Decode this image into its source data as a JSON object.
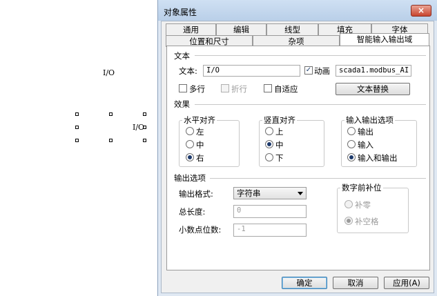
{
  "canvas": {
    "io_label_1": "I/O",
    "io_label_2": "I/O"
  },
  "dialog": {
    "title": "对象属性",
    "close_icon": "×",
    "tabs_row1": [
      "通用",
      "编辑",
      "线型",
      "填充",
      "字体"
    ],
    "tabs_row2": [
      "位置和尺寸",
      "杂项",
      "智能输入输出域"
    ],
    "active_tab": "智能输入输出域",
    "text_section": {
      "title": "文本",
      "text_label": "文本:",
      "text_value": "I/O",
      "animate_label": "动画",
      "animate_checked": true,
      "variable_value": "scada1.modbus_AI",
      "multiline_label": "多行",
      "wrap_label": "折行",
      "autofit_label": "自适应",
      "replace_button": "文本替换"
    },
    "effect_section": {
      "title": "效果",
      "h_align": {
        "title": "水平对齐",
        "options": [
          "左",
          "中",
          "右"
        ],
        "selected": "右"
      },
      "v_align": {
        "title": "竖直对齐",
        "options": [
          "上",
          "中",
          "下"
        ],
        "selected": "中"
      },
      "io_options": {
        "title": "输入输出选项",
        "options": [
          "输出",
          "输入",
          "输入和输出"
        ],
        "selected": "输入和输出"
      }
    },
    "output_section": {
      "title": "输出选项",
      "format_label": "输出格式:",
      "format_value": "字符串",
      "total_length_label": "总长度:",
      "total_length_value": "0",
      "decimals_label": "小数点位数:",
      "decimals_value": "-1",
      "padding": {
        "title": "数字前补位",
        "options": [
          "补零",
          "补空格"
        ],
        "selected": "补空格"
      }
    },
    "buttons": {
      "ok": "确定",
      "cancel": "取消",
      "apply": "应用(A)"
    }
  }
}
